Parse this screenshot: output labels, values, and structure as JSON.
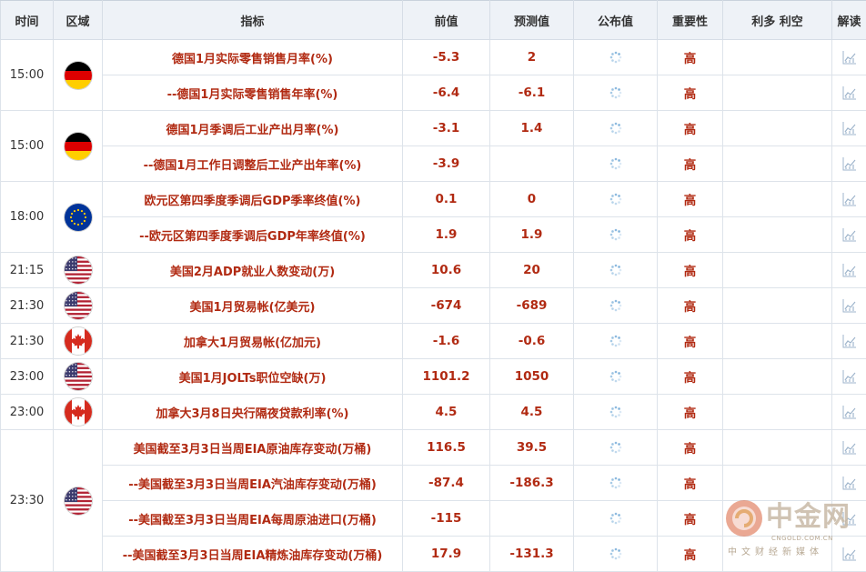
{
  "columns": {
    "time": "时间",
    "region": "区域",
    "indicator": "指标",
    "previous": "前值",
    "forecast": "预测值",
    "actual": "公布值",
    "importance": "重要性",
    "impact": "利多 利空",
    "interpret": "解读"
  },
  "groups": [
    {
      "time": "15:00",
      "flag": "germany-flag",
      "rows": [
        {
          "indicator": "德国1月实际零售销售月率(%)",
          "previous": "-5.3",
          "forecast": "2",
          "importance": "高"
        },
        {
          "indicator": "--德国1月实际零售销售年率(%)",
          "previous": "-6.4",
          "forecast": "-6.1",
          "importance": "高"
        }
      ]
    },
    {
      "time": "15:00",
      "flag": "germany-flag",
      "rows": [
        {
          "indicator": "德国1月季调后工业产出月率(%)",
          "previous": "-3.1",
          "forecast": "1.4",
          "importance": "高"
        },
        {
          "indicator": "--德国1月工作日调整后工业产出年率(%)",
          "previous": "-3.9",
          "forecast": "",
          "importance": "高"
        }
      ]
    },
    {
      "time": "18:00",
      "flag": "eu-flag",
      "rows": [
        {
          "indicator": "欧元区第四季度季调后GDP季率终值(%)",
          "previous": "0.1",
          "forecast": "0",
          "importance": "高"
        },
        {
          "indicator": "--欧元区第四季度季调后GDP年率终值(%)",
          "previous": "1.9",
          "forecast": "1.9",
          "importance": "高"
        }
      ]
    },
    {
      "time": "21:15",
      "flag": "usa-flag",
      "rows": [
        {
          "indicator": "美国2月ADP就业人数变动(万)",
          "previous": "10.6",
          "forecast": "20",
          "importance": "高"
        }
      ]
    },
    {
      "time": "21:30",
      "flag": "usa-flag",
      "rows": [
        {
          "indicator": "美国1月贸易帐(亿美元)",
          "previous": "-674",
          "forecast": "-689",
          "importance": "高"
        }
      ]
    },
    {
      "time": "21:30",
      "flag": "canada-flag",
      "rows": [
        {
          "indicator": "加拿大1月贸易帐(亿加元)",
          "previous": "-1.6",
          "forecast": "-0.6",
          "importance": "高"
        }
      ]
    },
    {
      "time": "23:00",
      "flag": "usa-flag",
      "rows": [
        {
          "indicator": "美国1月JOLTs职位空缺(万)",
          "previous": "1101.2",
          "forecast": "1050",
          "importance": "高"
        }
      ]
    },
    {
      "time": "23:00",
      "flag": "canada-flag",
      "rows": [
        {
          "indicator": "加拿大3月8日央行隔夜贷款利率(%)",
          "previous": "4.5",
          "forecast": "4.5",
          "importance": "高"
        }
      ]
    },
    {
      "time": "23:30",
      "flag": "usa-flag",
      "rows": [
        {
          "indicator": "美国截至3月3日当周EIA原油库存变动(万桶)",
          "previous": "116.5",
          "forecast": "39.5",
          "importance": "高"
        },
        {
          "indicator": "--美国截至3月3日当周EIA汽油库存变动(万桶)",
          "previous": "-87.4",
          "forecast": "-186.3",
          "importance": "高"
        },
        {
          "indicator": "--美国截至3月3日当周EIA每周原油进口(万桶)",
          "previous": "-115",
          "forecast": "",
          "importance": "高"
        },
        {
          "indicator": "--美国截至3月3日当周EIA精炼油库存变动(万桶)",
          "previous": "17.9",
          "forecast": "-131.3",
          "importance": "高"
        }
      ]
    }
  ],
  "watermark": {
    "name": "中金网",
    "domain": "CNGOLD.COM.CN",
    "sub": "中文财经新媒体"
  },
  "colors": {
    "accent_red": "#b12a12",
    "header_bg": "#eef2f7",
    "border": "#dde3ea"
  }
}
